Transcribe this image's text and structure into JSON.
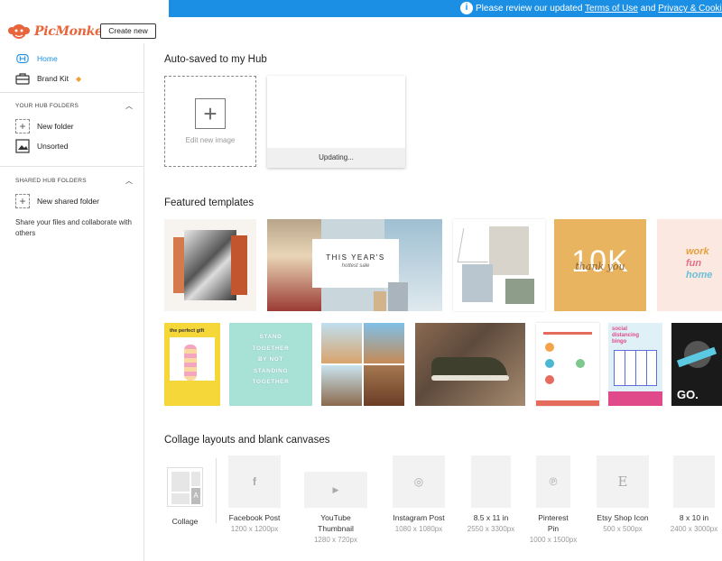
{
  "banner": {
    "prefix": "Please review our updated ",
    "link1": "Terms of Use",
    "middle": " and ",
    "link2": "Privacy & Cookies Policy",
    "info_icon": "info-icon"
  },
  "header": {
    "logo_text": "PicMonkey",
    "create_label": "Create new"
  },
  "sidebar": {
    "home": "Home",
    "brand_kit": "Brand Kit",
    "your_folders_title": "YOUR HUB FOLDERS",
    "new_folder": "New folder",
    "unsorted": "Unsorted",
    "shared_folders_title": "SHARED HUB FOLDERS",
    "new_shared_folder": "New shared folder",
    "share_text": "Share your files and collaborate with others"
  },
  "autosaved": {
    "title": "Auto-saved to my Hub",
    "edit_label": "Edit new image",
    "updating_label": "Updating..."
  },
  "featured": {
    "title": "Featured templates",
    "texts": {
      "years_title": "THIS YEAR'S",
      "years_sub": "hottest sale",
      "ten_k": "10K",
      "thank_you": "thank you",
      "work": "work",
      "fun": "fun",
      "home": "home",
      "perfect_gift": "the perfect gift",
      "stand": "STAND",
      "together": "TOGETHER",
      "by_not": "BY NOT",
      "standing": "STANDING",
      "together2": "TOGETHER",
      "social": "social",
      "distancing": "distancing",
      "bingo": "bingo",
      "go": "GO."
    }
  },
  "collage": {
    "title": "Collage layouts and blank canvases",
    "collage_label": "Collage",
    "items": [
      {
        "name": "Facebook Post",
        "size": "1200 x 1200px",
        "icon": "facebook-icon",
        "glyph": "f"
      },
      {
        "name": "YouTube Thumbnail",
        "size": "1280 x 720px",
        "icon": "youtube-icon",
        "glyph": "▶"
      },
      {
        "name": "Instagram Post",
        "size": "1080 x 1080px",
        "icon": "instagram-icon",
        "glyph": "◎"
      },
      {
        "name": "8.5 x 11 in",
        "size": "2550 x 3300px",
        "icon": "",
        "glyph": ""
      },
      {
        "name": "Pinterest Pin",
        "size": "1000 x 1500px",
        "icon": "pinterest-icon",
        "glyph": "℗"
      },
      {
        "name": "Etsy Shop Icon",
        "size": "500 x 500px",
        "icon": "etsy-icon",
        "glyph": "E"
      },
      {
        "name": "8 x 10 in",
        "size": "2400 x 3000px",
        "icon": "",
        "glyph": ""
      }
    ]
  },
  "colors": {
    "accent": "#1a8fe3",
    "brand": "#e8643a"
  }
}
